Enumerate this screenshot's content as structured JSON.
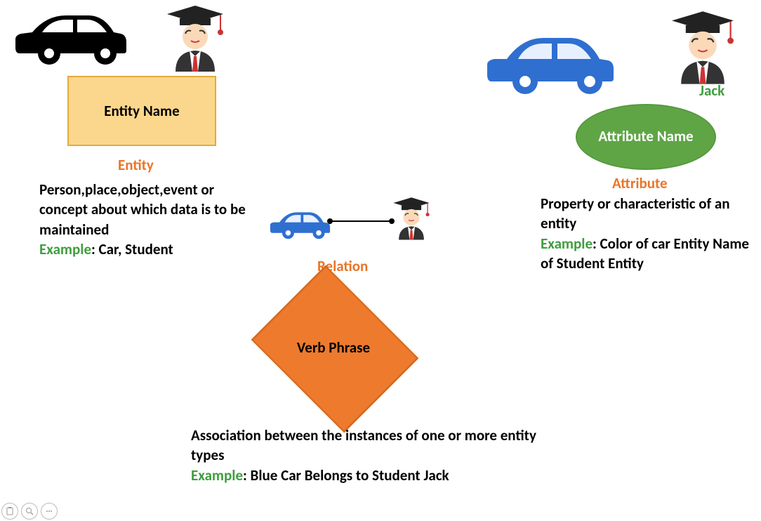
{
  "entity": {
    "shape_label": "Entity Name",
    "title": "Entity",
    "description": "Person,place,object,event or concept about which data is to be maintained",
    "example_label": "Example",
    "example_text": ": Car, Student"
  },
  "attribute": {
    "shape_label": "Attribute Name",
    "title": "Attribute",
    "character_name": "Jack",
    "description": "Property or characteristic of an entity",
    "example_label": "Example",
    "example_text": ": Color of car Entity Name of Student Entity"
  },
  "relation": {
    "shape_label": "Verb Phrase",
    "title": "Relation",
    "description": "Association between the instances of one or more entity types",
    "example_label": "Example",
    "example_text": ": Blue Car Belongs to Student Jack"
  },
  "icons": {
    "black_car": "black-car-icon",
    "blue_car": "blue-car-icon",
    "student": "student-icon"
  },
  "toolbar": {
    "clipboard": "clipboard-icon",
    "zoom": "zoom-icon",
    "more": "more-icon"
  }
}
